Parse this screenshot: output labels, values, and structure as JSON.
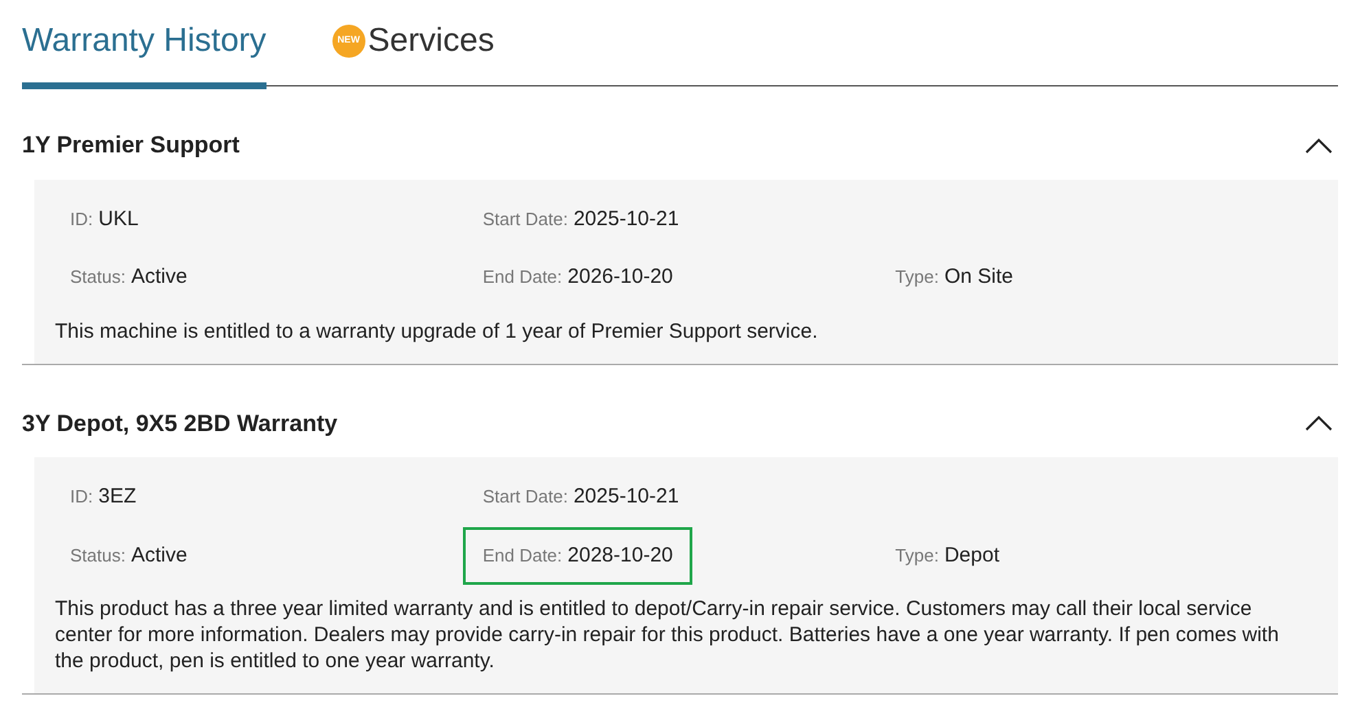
{
  "tabs": [
    {
      "label": "Warranty History",
      "selected": true
    },
    {
      "label": "Services",
      "selected": false,
      "badge": "NEW"
    }
  ],
  "warranties": [
    {
      "title": "1Y Premier Support",
      "expanded": true,
      "fields": [
        {
          "label": "ID:",
          "value": "UKL",
          "highlighted": false
        },
        {
          "label": "Start Date:",
          "value": "2025-10-21",
          "highlighted": false
        },
        {
          "label": "Status:",
          "value": "Active",
          "highlighted": false
        },
        {
          "label": "End Date:",
          "value": "2026-10-20",
          "highlighted": false
        },
        {
          "label": "Type:",
          "value": "On Site",
          "highlighted": false
        }
      ],
      "description": "This machine is entitled to a warranty upgrade of 1 year of Premier Support service."
    },
    {
      "title": "3Y Depot, 9X5 2BD Warranty",
      "expanded": true,
      "fields": [
        {
          "label": "ID:",
          "value": "3EZ",
          "highlighted": false
        },
        {
          "label": "Start Date:",
          "value": "2025-10-21",
          "highlighted": false
        },
        {
          "label": "Status:",
          "value": "Active",
          "highlighted": false
        },
        {
          "label": "End Date:",
          "value": "2028-10-20",
          "highlighted": true
        },
        {
          "label": "Type:",
          "value": "Depot",
          "highlighted": false
        }
      ],
      "description": "This product has a three year limited warranty and is entitled to depot/Carry-in repair service. Customers may call their local service center for more information. Dealers may provide carry-in repair for this product. Batteries have a one year warranty. If pen comes with the product, pen is entitled to one year warranty."
    }
  ]
}
